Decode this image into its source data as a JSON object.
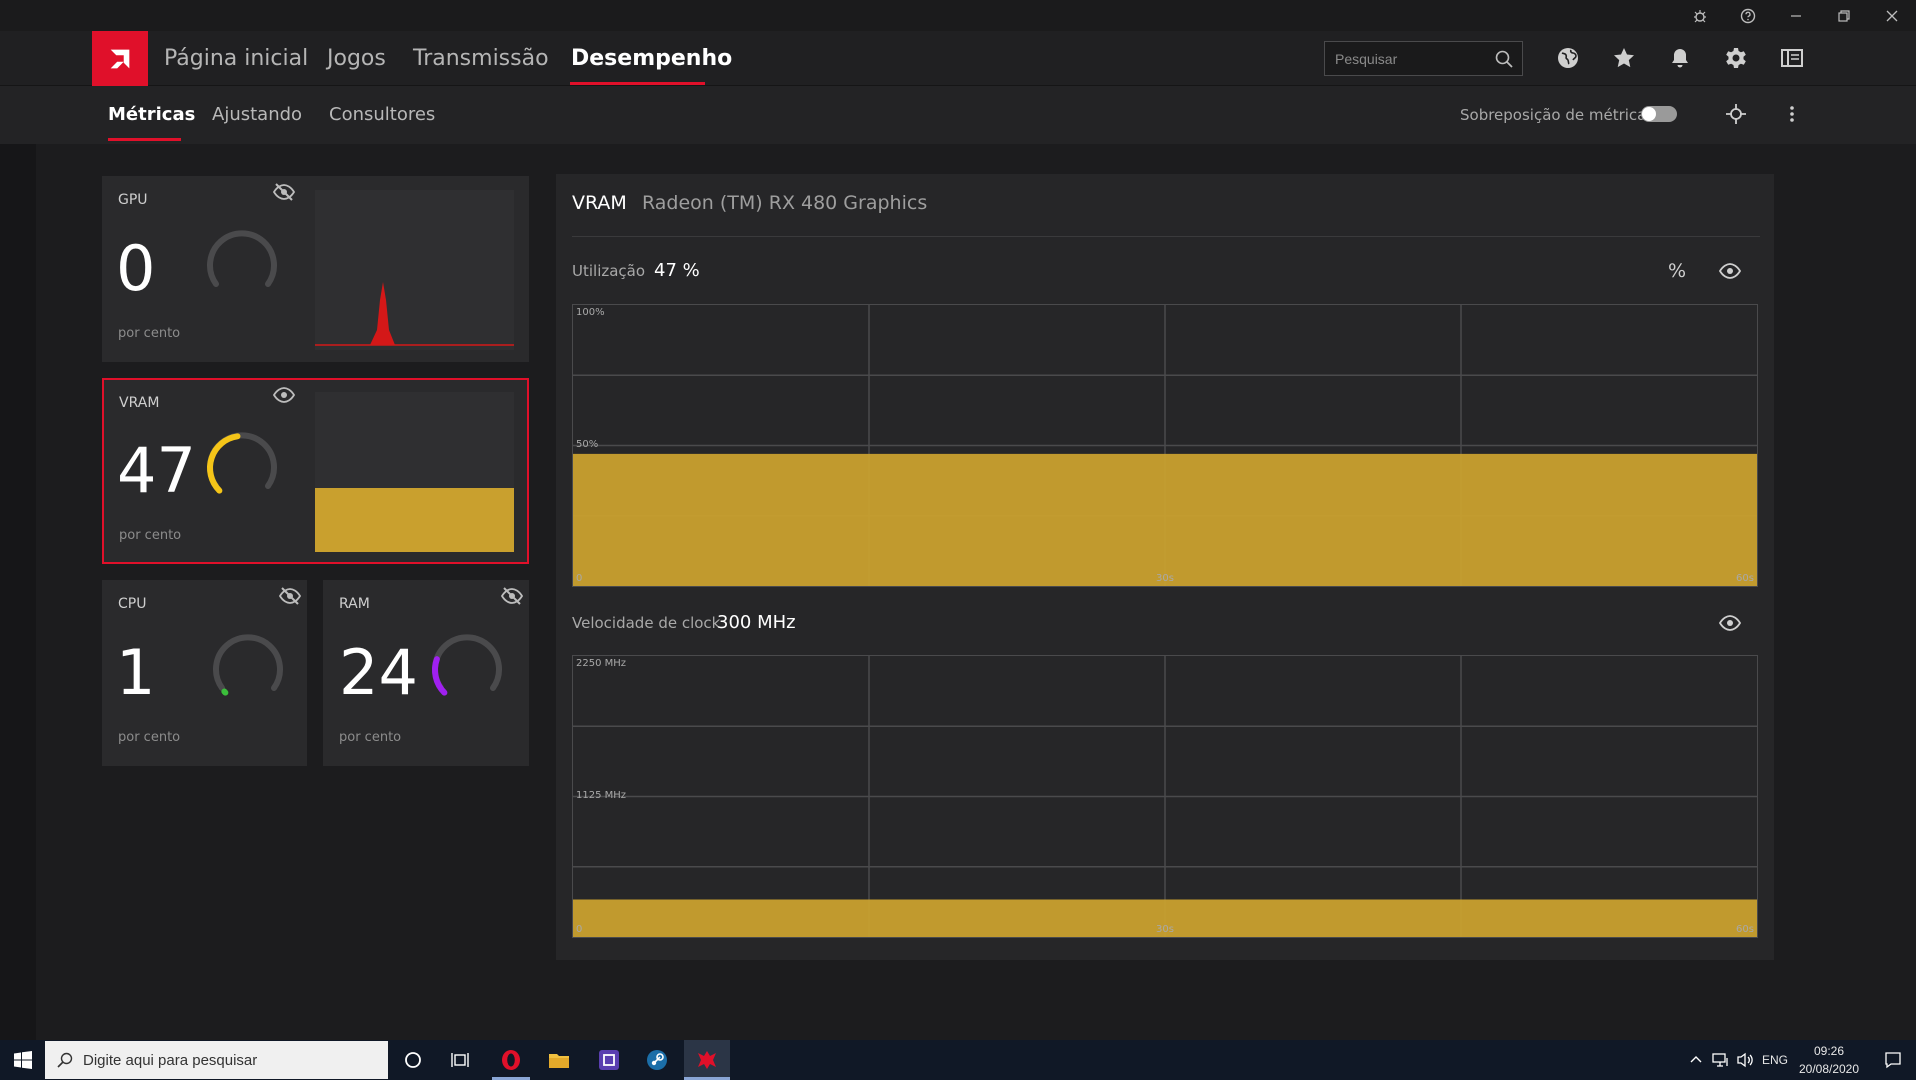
{
  "nav": {
    "items": [
      {
        "label": "Página inicial"
      },
      {
        "label": "Jogos"
      },
      {
        "label": "Transmissão"
      },
      {
        "label": "Desempenho",
        "active": true
      }
    ],
    "search_placeholder": "Pesquisar"
  },
  "subnav": {
    "tabs": [
      {
        "label": "Métricas",
        "active": true
      },
      {
        "label": "Ajustando"
      },
      {
        "label": "Consultores"
      }
    ],
    "overlay_label": "Sobreposição de métricas",
    "overlay_enabled": false
  },
  "cards": {
    "gpu": {
      "title": "GPU",
      "value": "0",
      "unit": "por cento",
      "visibility_icon": "eye-off-icon",
      "level": 0
    },
    "vram": {
      "title": "VRAM",
      "value": "47",
      "unit": "por cento",
      "visibility_icon": "eye-icon",
      "level": 47,
      "selected": true
    },
    "cpu": {
      "title": "CPU",
      "value": "1",
      "unit": "por cento",
      "visibility_icon": "eye-off-icon",
      "level": 1
    },
    "ram": {
      "title": "RAM",
      "value": "24",
      "unit": "por cento",
      "visibility_icon": "eye-off-icon",
      "level": 24
    }
  },
  "detail": {
    "title": "VRAM",
    "device": "Radeon (TM) RX 480 Graphics",
    "utilization_label": "Utilização",
    "utilization_value": "47 %",
    "percent_symbol": "%",
    "clock_label": "Velocidade de clock",
    "clock_value": "300 MHz"
  },
  "chart_data": [
    {
      "type": "area",
      "ylabels": [
        "100%",
        "50%",
        "0"
      ],
      "ylim": [
        0,
        100
      ],
      "xlabels": [
        "30s",
        "60s"
      ],
      "x": [
        0,
        60
      ],
      "series": [
        {
          "values": [
            47,
            47
          ]
        }
      ],
      "grid": true
    },
    {
      "type": "area",
      "ylabels": [
        "2250 MHz",
        "1125 MHz",
        "0"
      ],
      "ylim": [
        0,
        2250
      ],
      "xlabels": [
        "30s",
        "60s"
      ],
      "x": [
        0,
        60
      ],
      "series": [
        {
          "values": [
            300,
            300
          ]
        }
      ],
      "grid": true
    }
  ],
  "colors": {
    "accent": "#e0102a",
    "vram": "#f5c518",
    "vram_fill": "#c9a02e",
    "gpu_fill": "#d41818",
    "ram_arc": "#a020f0",
    "cpu_arc": "#3bbf3b"
  },
  "taskbar": {
    "search_placeholder": "Digite aqui para pesquisar",
    "language": "ENG",
    "time": "09:26",
    "date": "20/08/2020"
  }
}
